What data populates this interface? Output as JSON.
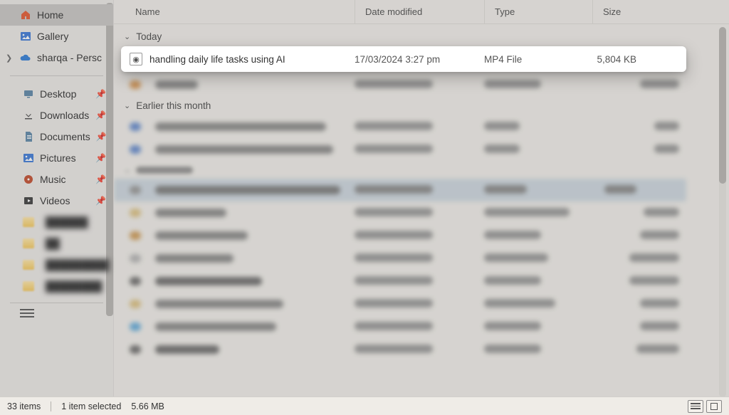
{
  "sidebar": {
    "top": [
      {
        "label": "Home",
        "icon": "home-icon",
        "selected": true
      },
      {
        "label": "Gallery",
        "icon": "gallery-icon",
        "selected": false
      },
      {
        "label": "sharqa - Persc",
        "icon": "cloud-icon",
        "selected": false,
        "expandable": true
      }
    ],
    "quick": [
      {
        "label": "Desktop",
        "icon": "desktop-icon",
        "pinned": true
      },
      {
        "label": "Downloads",
        "icon": "download-icon",
        "pinned": true
      },
      {
        "label": "Documents",
        "icon": "documents-icon",
        "pinned": true
      },
      {
        "label": "Pictures",
        "icon": "pictures-icon",
        "pinned": true
      },
      {
        "label": "Music",
        "icon": "music-icon",
        "pinned": true
      },
      {
        "label": "Videos",
        "icon": "videos-icon",
        "pinned": true
      }
    ]
  },
  "columns": {
    "name": "Name",
    "date": "Date modified",
    "type": "Type",
    "size": "Size"
  },
  "groups": {
    "today": "Today",
    "earlier_month": "Earlier this month"
  },
  "highlight_file": {
    "name": "handling daily life tasks using AI",
    "date": "17/03/2024 3:27 pm",
    "type": "MP4 File",
    "size": "5,804 KB"
  },
  "status": {
    "count": "33 items",
    "selection": "1 item selected",
    "size": "5.66 MB"
  }
}
